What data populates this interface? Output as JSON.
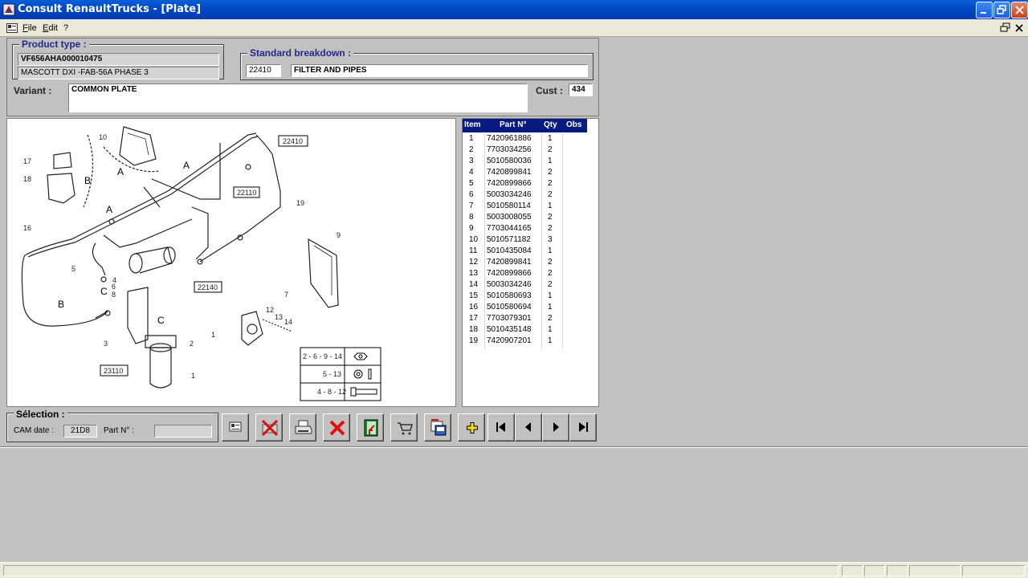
{
  "window": {
    "title": "Consult RenaultTrucks - [Plate]"
  },
  "menu": {
    "file": "File",
    "edit": "Edit",
    "help": "?"
  },
  "product_type": {
    "title": "Product type :",
    "vin": "VF656AHA000010475",
    "model": "MASCOTT DXI -FAB-56A PHASE 3"
  },
  "standard_breakdown": {
    "title": "Standard breakdown :",
    "code": "22410",
    "name": "FILTER AND PIPES"
  },
  "variant": {
    "label": "Variant :",
    "value": "COMMON PLATE"
  },
  "cust": {
    "label": "Cust :",
    "value": "434"
  },
  "drawing": {
    "refs": [
      "22110",
      "22140",
      "22410",
      "23110"
    ],
    "callouts": [
      "1",
      "2",
      "3",
      "4",
      "5",
      "6",
      "7",
      "8",
      "9",
      "10",
      "12",
      "13",
      "14",
      "16",
      "17",
      "18",
      "19"
    ],
    "views": [
      "A",
      "A",
      "A",
      "B",
      "B",
      "C",
      "C"
    ],
    "legend": [
      {
        "items": "2 - 6 - 9 - 14",
        "icon": "nut-icon"
      },
      {
        "items": "5 - 13",
        "icon": "washer-icon"
      },
      {
        "items": "4 - 8 - 12",
        "icon": "bolt-icon"
      }
    ]
  },
  "parts_table": {
    "headers": {
      "item": "Item",
      "part": "Part N°",
      "qty": "Qty",
      "obs": "Obs"
    },
    "rows": [
      {
        "item": "1",
        "part": "7420961886",
        "qty": "1"
      },
      {
        "item": "2",
        "part": "7703034256",
        "qty": "2"
      },
      {
        "item": "3",
        "part": "5010580036",
        "qty": "1"
      },
      {
        "item": "4",
        "part": "7420899841",
        "qty": "2"
      },
      {
        "item": "5",
        "part": "7420899866",
        "qty": "2"
      },
      {
        "item": "6",
        "part": "5003034246",
        "qty": "2"
      },
      {
        "item": "7",
        "part": "5010580114",
        "qty": "1"
      },
      {
        "item": "8",
        "part": "5003008055",
        "qty": "2"
      },
      {
        "item": "9",
        "part": "7703044165",
        "qty": "2"
      },
      {
        "item": "10",
        "part": "5010571182",
        "qty": "3"
      },
      {
        "item": "11",
        "part": "5010435084",
        "qty": "1"
      },
      {
        "item": "12",
        "part": "7420899841",
        "qty": "2"
      },
      {
        "item": "13",
        "part": "7420899866",
        "qty": "2"
      },
      {
        "item": "14",
        "part": "5003034246",
        "qty": "2"
      },
      {
        "item": "15",
        "part": "5010580693",
        "qty": "1"
      },
      {
        "item": "16",
        "part": "5010580694",
        "qty": "1"
      },
      {
        "item": "17",
        "part": "7703079301",
        "qty": "2"
      },
      {
        "item": "18",
        "part": "5010435148",
        "qty": "1"
      },
      {
        "item": "19",
        "part": "7420907201",
        "qty": "1"
      }
    ]
  },
  "selection": {
    "title": "Sélection :",
    "cam_label": "CAM date :",
    "cam_value": "21D8",
    "part_label": "Part N° :",
    "part_value": ""
  },
  "toolbar": {
    "icons": [
      "card-icon",
      "cancel-selection-icon",
      "print-icon",
      "delete-icon",
      "exit-icon",
      "cart-icon",
      "export-icon",
      "add-icon",
      "first-icon",
      "previous-icon",
      "next-icon",
      "last-icon"
    ]
  },
  "colors": {
    "title_bar": "#0048c8",
    "table_header": "#081a80",
    "group_title": "#1f2a8c",
    "background": "#c3c0c0"
  }
}
